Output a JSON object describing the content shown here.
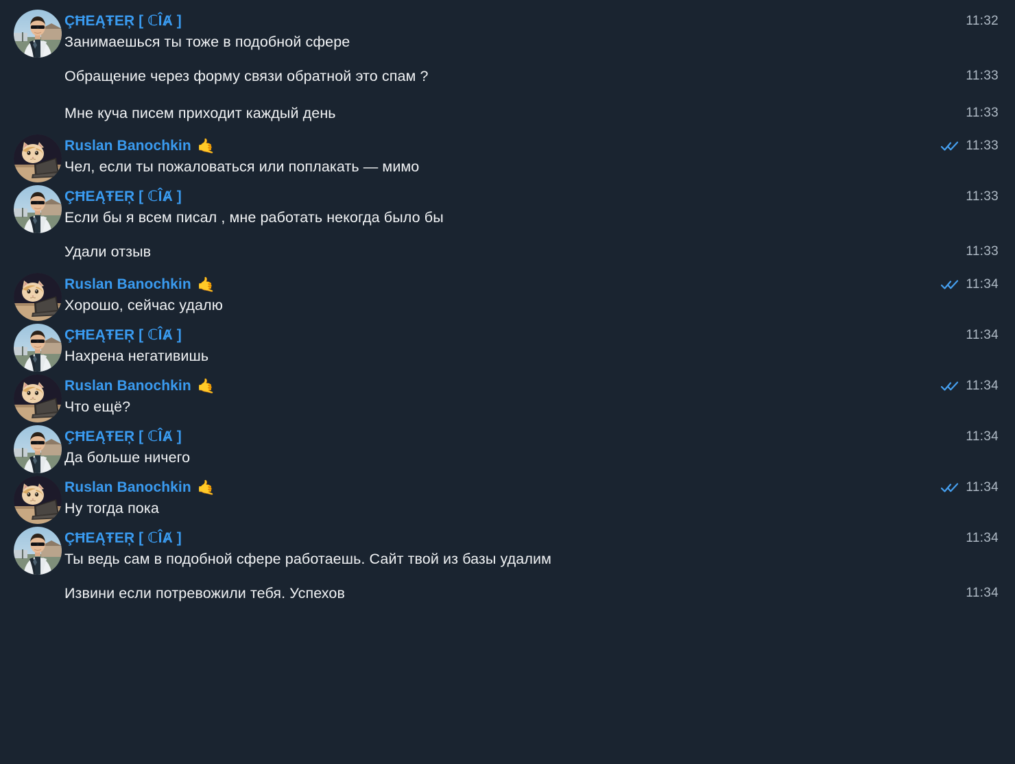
{
  "theme": {
    "background": "#1a2430",
    "sender_name_color": "#3a9bf0",
    "message_text_color": "#f1f3f5",
    "timestamp_color": "#aeb9c4",
    "read_tick_color": "#46a0f0"
  },
  "participants": [
    {
      "id": "cheater",
      "name": "ÇĦEĄŦEŖ [ ℂÎȺ ]",
      "emoji": "",
      "avatar": "man-in-white-jacket-sunglasses-photo"
    },
    {
      "id": "ruslan",
      "name": "Ruslan Banochkin",
      "emoji": "🤙",
      "avatar": "cat-at-laptop-photo"
    }
  ],
  "messages": [
    {
      "sender_id": "cheater",
      "sender_name": "ÇĦEĄŦEŖ [ ℂÎȺ ]",
      "emoji": "",
      "text": "Занимаешься ты тоже в подобной сфере",
      "time": "11:32",
      "show_header": true,
      "read": false
    },
    {
      "sender_id": "cheater",
      "sender_name": "",
      "emoji": "",
      "text": "Обращение через форму связи обратной это спам ?",
      "time": "11:33",
      "show_header": false,
      "read": false
    },
    {
      "sender_id": "cheater",
      "sender_name": "",
      "emoji": "",
      "text": "Мне куча писем приходит каждый день",
      "time": "11:33",
      "show_header": false,
      "read": false
    },
    {
      "sender_id": "ruslan",
      "sender_name": "Ruslan Banochkin",
      "emoji": "🤙",
      "text": "Чел, если ты пожаловаться или поплакать — мимо",
      "time": "11:33",
      "show_header": true,
      "read": true
    },
    {
      "sender_id": "cheater",
      "sender_name": "ÇĦEĄŦEŖ [ ℂÎȺ ]",
      "emoji": "",
      "text": "Если бы я всем писал , мне работать некогда было бы",
      "time": "11:33",
      "show_header": true,
      "read": false
    },
    {
      "sender_id": "cheater",
      "sender_name": "",
      "emoji": "",
      "text": "Удали отзыв",
      "time": "11:33",
      "show_header": false,
      "read": false
    },
    {
      "sender_id": "ruslan",
      "sender_name": "Ruslan Banochkin",
      "emoji": "🤙",
      "text": "Хорошо, сейчас удалю",
      "time": "11:34",
      "show_header": true,
      "read": true
    },
    {
      "sender_id": "cheater",
      "sender_name": "ÇĦEĄŦEŖ [ ℂÎȺ ]",
      "emoji": "",
      "text": "Нахрена негативишь",
      "time": "11:34",
      "show_header": true,
      "read": false
    },
    {
      "sender_id": "ruslan",
      "sender_name": "Ruslan Banochkin",
      "emoji": "🤙",
      "text": "Что ещё?",
      "time": "11:34",
      "show_header": true,
      "read": true
    },
    {
      "sender_id": "cheater",
      "sender_name": "ÇĦEĄŦEŖ [ ℂÎȺ ]",
      "emoji": "",
      "text": "Да больше ничего",
      "time": "11:34",
      "show_header": true,
      "read": false
    },
    {
      "sender_id": "ruslan",
      "sender_name": "Ruslan Banochkin",
      "emoji": "🤙",
      "text": "Ну тогда пока",
      "time": "11:34",
      "show_header": true,
      "read": true
    },
    {
      "sender_id": "cheater",
      "sender_name": "ÇĦEĄŦEŖ [ ℂÎȺ ]",
      "emoji": "",
      "text": "Ты ведь сам в подобной сфере работаешь. Сайт твой из базы удалим",
      "time": "11:34",
      "show_header": true,
      "read": false
    },
    {
      "sender_id": "cheater",
      "sender_name": "",
      "emoji": "",
      "text": "Извини если потревожили тебя. Успехов",
      "time": "11:34",
      "show_header": false,
      "read": false
    }
  ]
}
